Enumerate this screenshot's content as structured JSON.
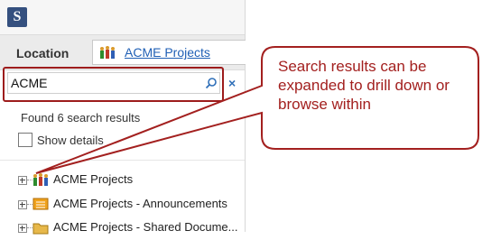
{
  "location": {
    "label": "Location",
    "current": "ACME Projects"
  },
  "search": {
    "value": "ACME",
    "clear_symbol": "×"
  },
  "results": {
    "summary": "Found 6 search results",
    "show_details_label": "Show details",
    "items": [
      {
        "label": "ACME Projects",
        "icon": "site-people-icon"
      },
      {
        "label": "ACME Projects - Announcements",
        "icon": "list-icon"
      },
      {
        "label": "ACME Projects - Shared Docume...",
        "icon": "library-folder-icon"
      }
    ]
  },
  "callout": {
    "text": "Search results can be expanded to drill down or browse within"
  },
  "colors": {
    "callout_border": "#a3201f",
    "link": "#1f5fb5",
    "logo": "#35507f"
  }
}
